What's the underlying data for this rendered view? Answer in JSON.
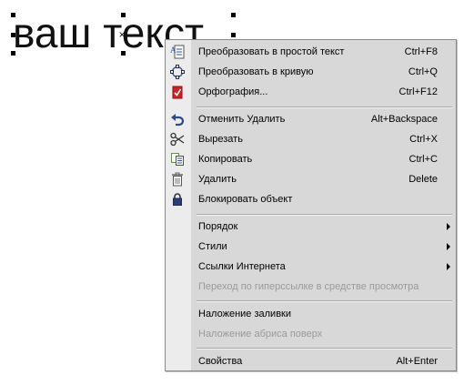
{
  "canvas": {
    "text": "ваш текст"
  },
  "menu": {
    "items": [
      {
        "label": "Преобразовать в простой текст",
        "shortcut": "Ctrl+F8",
        "icon": "text-convert-icon"
      },
      {
        "label": "Преобразовать в кривую",
        "shortcut": "Ctrl+Q",
        "icon": "curve-convert-icon"
      },
      {
        "label": "Орфография...",
        "shortcut": "Ctrl+F12",
        "icon": "spellcheck-icon"
      },
      {
        "label": "Отменить Удалить",
        "shortcut": "Alt+Backspace",
        "icon": "undo-icon"
      },
      {
        "label": "Вырезать",
        "shortcut": "Ctrl+X",
        "icon": "scissors-icon"
      },
      {
        "label": "Копировать",
        "shortcut": "Ctrl+C",
        "icon": "copy-icon"
      },
      {
        "label": "Удалить",
        "shortcut": "Delete",
        "icon": "trash-icon"
      },
      {
        "label": "Блокировать объект",
        "shortcut": "",
        "icon": "lock-icon"
      },
      {
        "label": "Порядок",
        "shortcut": "",
        "submenu": true
      },
      {
        "label": "Стили",
        "shortcut": "",
        "submenu": true
      },
      {
        "label": "Ссылки Интернета",
        "shortcut": "",
        "submenu": true
      },
      {
        "label": "Переход по гиперссылке в средстве просмотра",
        "shortcut": "",
        "disabled": true
      },
      {
        "label": "Наложение заливки",
        "shortcut": ""
      },
      {
        "label": "Наложение абриса поверх",
        "shortcut": "",
        "disabled": true
      },
      {
        "label": "Свойства",
        "shortcut": "Alt+Enter"
      }
    ]
  },
  "colors": {
    "menu_bg": "#d8d8d8",
    "gutter_bg": "#ececec",
    "disabled_text": "#9a9a9a",
    "icon_red": "#d42020",
    "icon_blue": "#2a4fa8"
  }
}
